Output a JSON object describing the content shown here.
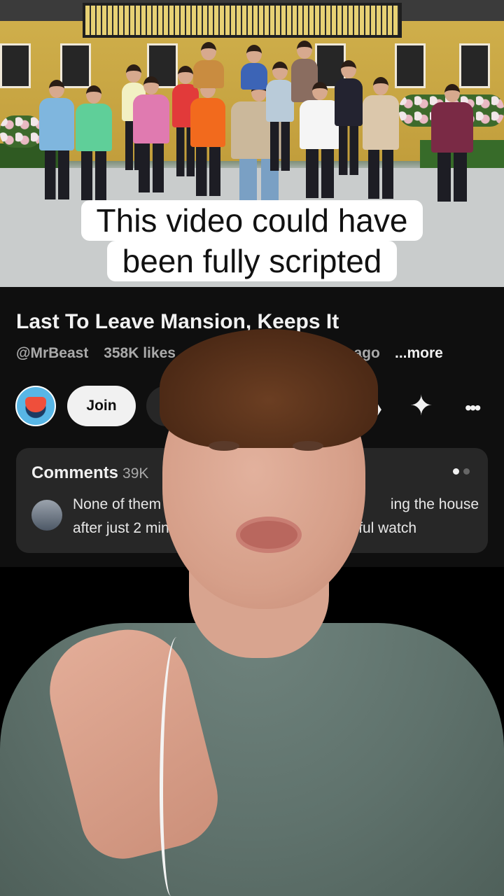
{
  "video": {
    "caption_line1": "This video could have",
    "caption_line2": "been fully scripted"
  },
  "youtube": {
    "title": "Last To Leave Mansion, Keeps It",
    "channel": "@MrBeast",
    "likes": "358K likes",
    "age": "h ago",
    "more_label": "...more",
    "join_label": "Join",
    "comments": {
      "label": "Comments",
      "count": "39K",
      "preview_line1_left": "None of them c",
      "preview_line1_right": "ing the house",
      "preview_line2_left": "after just 2 min",
      "preview_line2_right": "ful watch"
    }
  },
  "icons": {
    "share": "share-icon",
    "ai": "sparkle-icon",
    "menu": "more-vert-icon"
  },
  "colors": {
    "background": "#0f0f0f",
    "card": "#272727",
    "caption_bg": "#ffffff"
  }
}
